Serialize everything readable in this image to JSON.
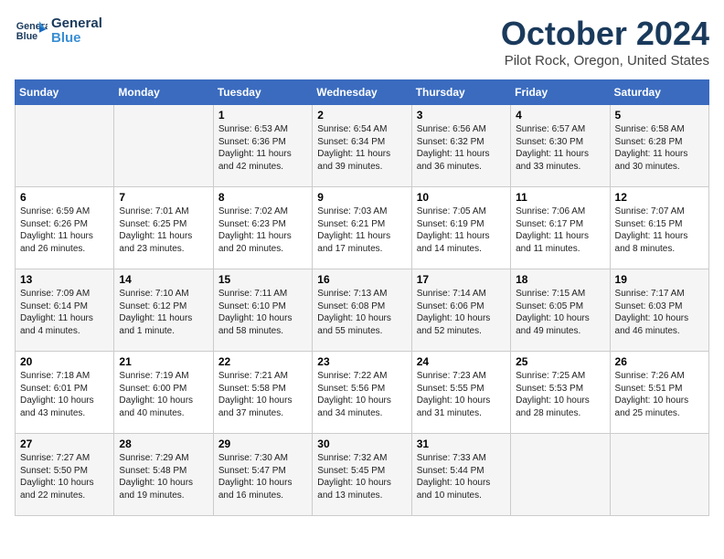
{
  "header": {
    "logo_line1": "General",
    "logo_line2": "Blue",
    "month": "October 2024",
    "location": "Pilot Rock, Oregon, United States"
  },
  "weekdays": [
    "Sunday",
    "Monday",
    "Tuesday",
    "Wednesday",
    "Thursday",
    "Friday",
    "Saturday"
  ],
  "weeks": [
    [
      {
        "day": "",
        "sunrise": "",
        "sunset": "",
        "daylight": ""
      },
      {
        "day": "",
        "sunrise": "",
        "sunset": "",
        "daylight": ""
      },
      {
        "day": "1",
        "sunrise": "Sunrise: 6:53 AM",
        "sunset": "Sunset: 6:36 PM",
        "daylight": "Daylight: 11 hours and 42 minutes."
      },
      {
        "day": "2",
        "sunrise": "Sunrise: 6:54 AM",
        "sunset": "Sunset: 6:34 PM",
        "daylight": "Daylight: 11 hours and 39 minutes."
      },
      {
        "day": "3",
        "sunrise": "Sunrise: 6:56 AM",
        "sunset": "Sunset: 6:32 PM",
        "daylight": "Daylight: 11 hours and 36 minutes."
      },
      {
        "day": "4",
        "sunrise": "Sunrise: 6:57 AM",
        "sunset": "Sunset: 6:30 PM",
        "daylight": "Daylight: 11 hours and 33 minutes."
      },
      {
        "day": "5",
        "sunrise": "Sunrise: 6:58 AM",
        "sunset": "Sunset: 6:28 PM",
        "daylight": "Daylight: 11 hours and 30 minutes."
      }
    ],
    [
      {
        "day": "6",
        "sunrise": "Sunrise: 6:59 AM",
        "sunset": "Sunset: 6:26 PM",
        "daylight": "Daylight: 11 hours and 26 minutes."
      },
      {
        "day": "7",
        "sunrise": "Sunrise: 7:01 AM",
        "sunset": "Sunset: 6:25 PM",
        "daylight": "Daylight: 11 hours and 23 minutes."
      },
      {
        "day": "8",
        "sunrise": "Sunrise: 7:02 AM",
        "sunset": "Sunset: 6:23 PM",
        "daylight": "Daylight: 11 hours and 20 minutes."
      },
      {
        "day": "9",
        "sunrise": "Sunrise: 7:03 AM",
        "sunset": "Sunset: 6:21 PM",
        "daylight": "Daylight: 11 hours and 17 minutes."
      },
      {
        "day": "10",
        "sunrise": "Sunrise: 7:05 AM",
        "sunset": "Sunset: 6:19 PM",
        "daylight": "Daylight: 11 hours and 14 minutes."
      },
      {
        "day": "11",
        "sunrise": "Sunrise: 7:06 AM",
        "sunset": "Sunset: 6:17 PM",
        "daylight": "Daylight: 11 hours and 11 minutes."
      },
      {
        "day": "12",
        "sunrise": "Sunrise: 7:07 AM",
        "sunset": "Sunset: 6:15 PM",
        "daylight": "Daylight: 11 hours and 8 minutes."
      }
    ],
    [
      {
        "day": "13",
        "sunrise": "Sunrise: 7:09 AM",
        "sunset": "Sunset: 6:14 PM",
        "daylight": "Daylight: 11 hours and 4 minutes."
      },
      {
        "day": "14",
        "sunrise": "Sunrise: 7:10 AM",
        "sunset": "Sunset: 6:12 PM",
        "daylight": "Daylight: 11 hours and 1 minute."
      },
      {
        "day": "15",
        "sunrise": "Sunrise: 7:11 AM",
        "sunset": "Sunset: 6:10 PM",
        "daylight": "Daylight: 10 hours and 58 minutes."
      },
      {
        "day": "16",
        "sunrise": "Sunrise: 7:13 AM",
        "sunset": "Sunset: 6:08 PM",
        "daylight": "Daylight: 10 hours and 55 minutes."
      },
      {
        "day": "17",
        "sunrise": "Sunrise: 7:14 AM",
        "sunset": "Sunset: 6:06 PM",
        "daylight": "Daylight: 10 hours and 52 minutes."
      },
      {
        "day": "18",
        "sunrise": "Sunrise: 7:15 AM",
        "sunset": "Sunset: 6:05 PM",
        "daylight": "Daylight: 10 hours and 49 minutes."
      },
      {
        "day": "19",
        "sunrise": "Sunrise: 7:17 AM",
        "sunset": "Sunset: 6:03 PM",
        "daylight": "Daylight: 10 hours and 46 minutes."
      }
    ],
    [
      {
        "day": "20",
        "sunrise": "Sunrise: 7:18 AM",
        "sunset": "Sunset: 6:01 PM",
        "daylight": "Daylight: 10 hours and 43 minutes."
      },
      {
        "day": "21",
        "sunrise": "Sunrise: 7:19 AM",
        "sunset": "Sunset: 6:00 PM",
        "daylight": "Daylight: 10 hours and 40 minutes."
      },
      {
        "day": "22",
        "sunrise": "Sunrise: 7:21 AM",
        "sunset": "Sunset: 5:58 PM",
        "daylight": "Daylight: 10 hours and 37 minutes."
      },
      {
        "day": "23",
        "sunrise": "Sunrise: 7:22 AM",
        "sunset": "Sunset: 5:56 PM",
        "daylight": "Daylight: 10 hours and 34 minutes."
      },
      {
        "day": "24",
        "sunrise": "Sunrise: 7:23 AM",
        "sunset": "Sunset: 5:55 PM",
        "daylight": "Daylight: 10 hours and 31 minutes."
      },
      {
        "day": "25",
        "sunrise": "Sunrise: 7:25 AM",
        "sunset": "Sunset: 5:53 PM",
        "daylight": "Daylight: 10 hours and 28 minutes."
      },
      {
        "day": "26",
        "sunrise": "Sunrise: 7:26 AM",
        "sunset": "Sunset: 5:51 PM",
        "daylight": "Daylight: 10 hours and 25 minutes."
      }
    ],
    [
      {
        "day": "27",
        "sunrise": "Sunrise: 7:27 AM",
        "sunset": "Sunset: 5:50 PM",
        "daylight": "Daylight: 10 hours and 22 minutes."
      },
      {
        "day": "28",
        "sunrise": "Sunrise: 7:29 AM",
        "sunset": "Sunset: 5:48 PM",
        "daylight": "Daylight: 10 hours and 19 minutes."
      },
      {
        "day": "29",
        "sunrise": "Sunrise: 7:30 AM",
        "sunset": "Sunset: 5:47 PM",
        "daylight": "Daylight: 10 hours and 16 minutes."
      },
      {
        "day": "30",
        "sunrise": "Sunrise: 7:32 AM",
        "sunset": "Sunset: 5:45 PM",
        "daylight": "Daylight: 10 hours and 13 minutes."
      },
      {
        "day": "31",
        "sunrise": "Sunrise: 7:33 AM",
        "sunset": "Sunset: 5:44 PM",
        "daylight": "Daylight: 10 hours and 10 minutes."
      },
      {
        "day": "",
        "sunrise": "",
        "sunset": "",
        "daylight": ""
      },
      {
        "day": "",
        "sunrise": "",
        "sunset": "",
        "daylight": ""
      }
    ]
  ]
}
